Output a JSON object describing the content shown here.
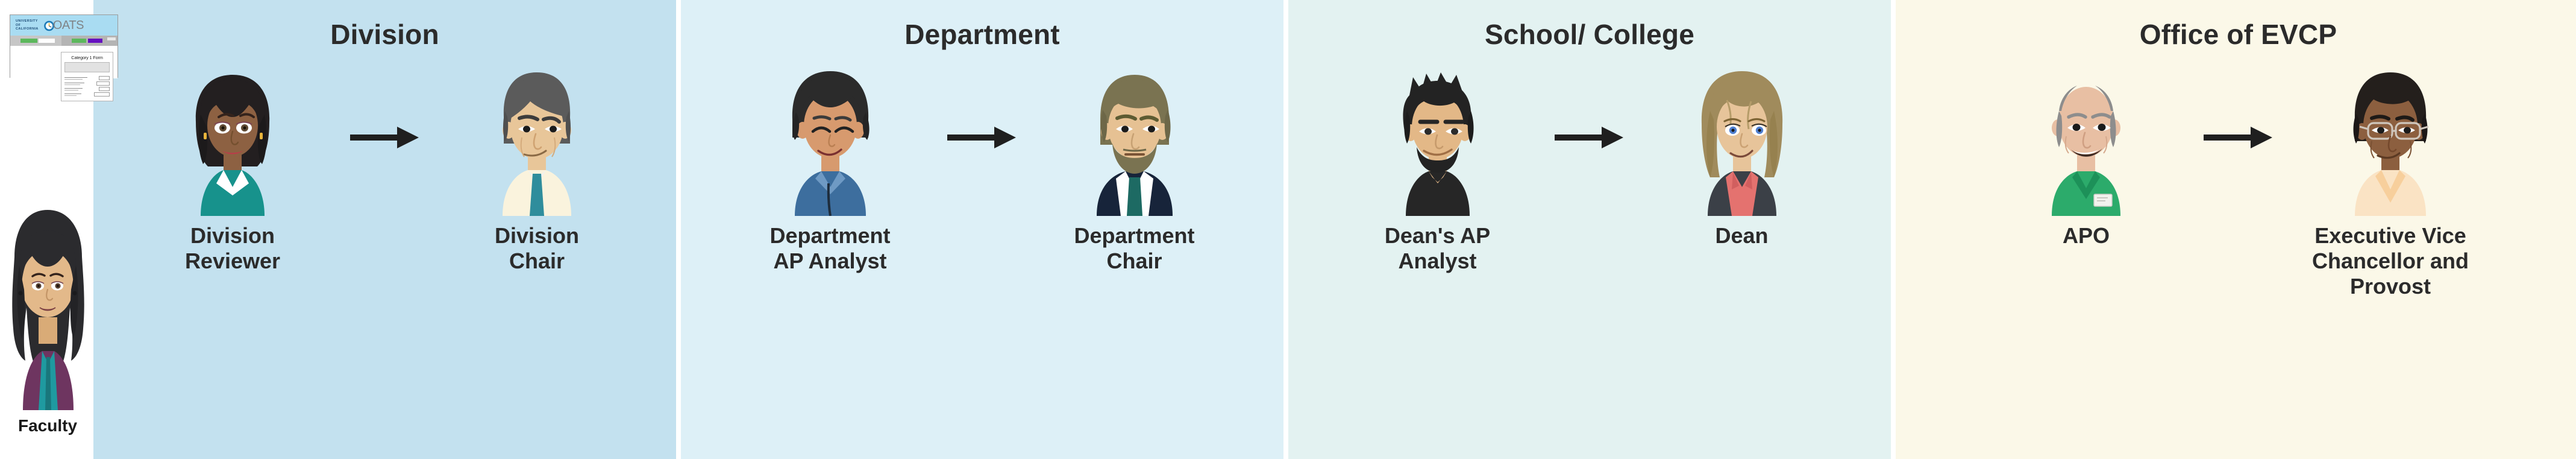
{
  "faculty": {
    "label": "Faculty",
    "app_window": {
      "brand_line1": "UNIVERSITY",
      "brand_line2": "OF",
      "brand_line3": "CALIFORNIA",
      "app_name": "OATS",
      "logo_icon": "clock-icon",
      "chip_colors": [
        "#5cb85c",
        "#ffffff",
        "#5cb85c",
        "#6610c0",
        "#e8e8e8"
      ]
    },
    "form_card": {
      "title": "Category 1 Form"
    }
  },
  "colors": {
    "division_bg": "#c3e1ef",
    "department_bg": "#ddf0f7",
    "school_bg": "#e3f2f1",
    "evcp_bg": "#fbf8e8",
    "text": "#2b2b2b",
    "arrow": "#1f1f1f"
  },
  "columns": [
    {
      "title": "Division",
      "people": [
        {
          "role": "Division\nReviewer",
          "role_line1": "Division",
          "role_line2": "Reviewer",
          "avatar": "woman-dark-bob-teal-blouse"
        },
        {
          "role": "Division\nChair",
          "role_line1": "Division",
          "role_line2": "Chair",
          "avatar": "man-gray-hair-cream-shirt-teal-tie"
        }
      ],
      "arrow": "right-arrow-icon"
    },
    {
      "title": "Department",
      "people": [
        {
          "role": "Department\nAP Analyst",
          "role_line1": "Department",
          "role_line2": "AP Analyst",
          "avatar": "man-black-hair-blue-shirt-lanyard"
        },
        {
          "role": "Department\nChair",
          "role_line1": "Department",
          "role_line2": "Chair",
          "avatar": "man-bearded-navy-suit-teal-tie"
        }
      ],
      "arrow": "right-arrow-icon"
    },
    {
      "title": "School/ College",
      "people": [
        {
          "role": "Dean's AP\nAnalyst",
          "role_line1": "Dean's AP",
          "role_line2": "Analyst",
          "avatar": "man-spiky-hair-goatee-black-tshirt"
        },
        {
          "role": "Dean",
          "role_line1": "Dean",
          "role_line2": "",
          "avatar": "woman-long-blonde-hair-blazer-pink-blouse"
        }
      ],
      "arrow": "right-arrow-icon"
    },
    {
      "title": "Office of EVCP",
      "people": [
        {
          "role": "APO",
          "role_line1": "APO",
          "role_line2": "",
          "avatar": "bald-man-green-polo-badge"
        },
        {
          "role": "Executive Vice\nChancellor and\nProvost",
          "role_line1": "Executive Vice",
          "role_line2": "Chancellor and",
          "role_line3": "Provost",
          "avatar": "man-glasses-dark-skin-cream-shirt"
        }
      ],
      "arrow": "right-arrow-icon"
    }
  ]
}
